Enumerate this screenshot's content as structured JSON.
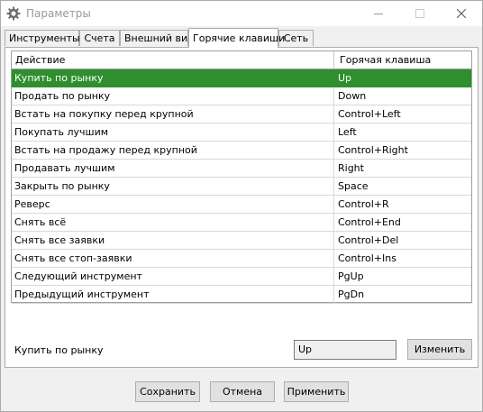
{
  "window": {
    "title": "Параметры",
    "icon": "gear-icon",
    "controls": [
      "minimize-icon",
      "maximize-icon",
      "close-icon"
    ]
  },
  "tabs": [
    {
      "label": "Инструменты"
    },
    {
      "label": "Счета"
    },
    {
      "label": "Внешний вид"
    },
    {
      "label": "Горячие клавиши",
      "active": true
    },
    {
      "label": "Сеть"
    }
  ],
  "grid": {
    "columns": [
      "Действие",
      "Горячая клавиша"
    ],
    "selected_color": "#2f8f2f",
    "rows": [
      {
        "action": "Купить по рынку",
        "key": "Up",
        "selected": true
      },
      {
        "action": "Продать по рынку",
        "key": "Down"
      },
      {
        "action": "Встать на покупку перед крупной",
        "key": "Control+Left"
      },
      {
        "action": "Покупать лучшим",
        "key": "Left"
      },
      {
        "action": "Встать на продажу перед крупной",
        "key": "Control+Right"
      },
      {
        "action": "Продавать лучшим",
        "key": "Right"
      },
      {
        "action": "Закрыть по рынку",
        "key": "Space"
      },
      {
        "action": "Реверс",
        "key": "Control+R"
      },
      {
        "action": "Снять всё",
        "key": "Control+End"
      },
      {
        "action": "Снять все заявки",
        "key": "Control+Del"
      },
      {
        "action": "Снять все стоп-заявки",
        "key": "Control+Ins"
      },
      {
        "action": "Следующий инструмент",
        "key": "PgUp"
      },
      {
        "action": "Предыдущий инструмент",
        "key": "PgDn"
      }
    ]
  },
  "editor": {
    "label": "Купить по рынку",
    "value": "Up",
    "change_label": "Изменить"
  },
  "footer": {
    "save_label": "Сохранить",
    "cancel_label": "Отмена",
    "apply_label": "Применить"
  }
}
